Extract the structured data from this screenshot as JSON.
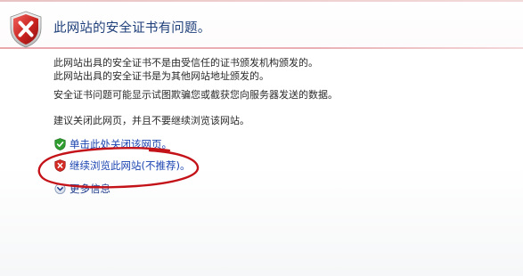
{
  "header": {
    "title": "此网站的安全证书有问题。",
    "icon": "shield-error-icon",
    "accent_color": "#1f3f7a",
    "rule_color": "#e9a8ad"
  },
  "content": {
    "para1_line1": "此网站出具的安全证书不是由受信任的证书颁发机构颁发的。",
    "para1_line2": "此网站出具的安全证书是为其他网站地址颁发的。",
    "para2": "安全证书问题可能显示试图欺骗您或截获您向服务器发送的数据。",
    "para3": "建议关闭此网页，并且不要继续浏览该网站。"
  },
  "actions": {
    "close_page": {
      "label": "单击此处关闭该网页。",
      "icon": "green-shield-check-icon"
    },
    "continue": {
      "label": "继续浏览此网站(不推荐)。",
      "icon": "red-shield-x-icon"
    },
    "more_info": {
      "label": "更多信息",
      "icon": "chevron-down-circle-icon"
    }
  },
  "annotation": {
    "type": "hand-drawn-ellipse",
    "color": "#c41219"
  }
}
